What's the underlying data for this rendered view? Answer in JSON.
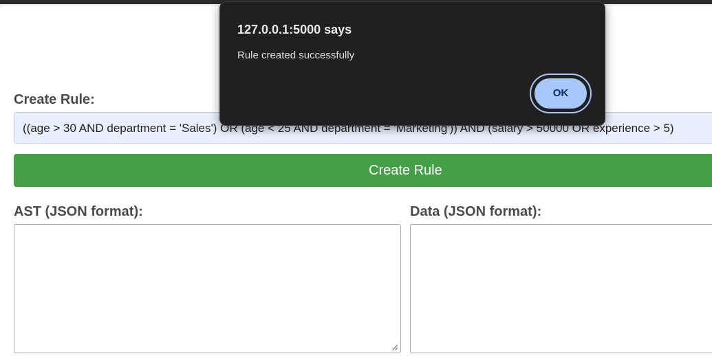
{
  "dialog": {
    "title": "127.0.0.1:5000 says",
    "message": "Rule created successfully",
    "ok_label": "OK"
  },
  "form": {
    "create_rule_label": "Create Rule:",
    "rule_value": "((age > 30 AND department = 'Sales') OR (age < 25 AND department = 'Marketing')) AND (salary > 50000 OR experience > 5)",
    "create_button_label": "Create Rule",
    "ast_label": "AST (JSON format):",
    "data_label": "Data (JSON format):",
    "ast_value": "",
    "data_value": ""
  },
  "colors": {
    "button_green": "#43a047",
    "input_bg": "#e9f0fd",
    "dialog_bg": "#202020",
    "ok_blue": "#a8c7fa"
  }
}
